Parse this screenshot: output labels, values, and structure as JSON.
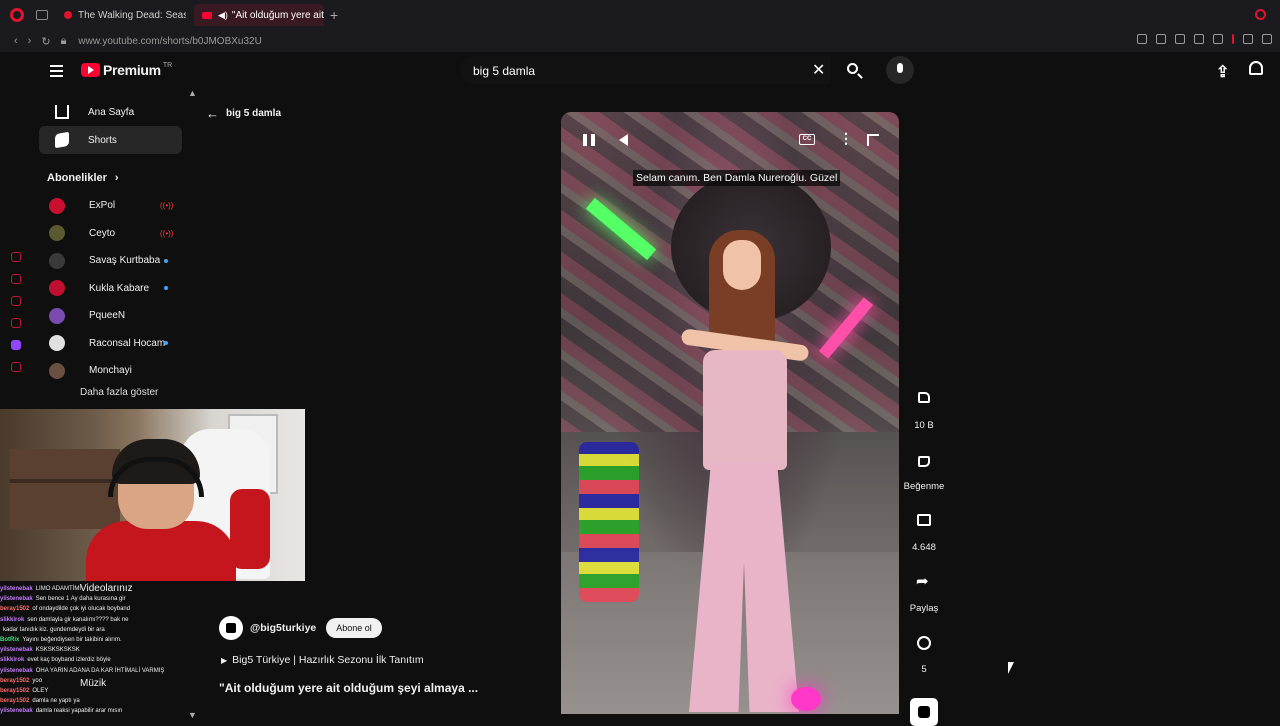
{
  "browser": {
    "tabs": [
      {
        "title": "The Walking Dead: Season",
        "active": false
      },
      {
        "title": "\"Ait olduğum yere ait o",
        "active": true
      }
    ],
    "new_tab": "+",
    "url": "www.youtube.com/shorts/b0JMOBXu32U"
  },
  "header": {
    "logo_text": "Premium",
    "logo_region": "TR",
    "search_value": "big 5 damla",
    "clear_symbol": "✕"
  },
  "sidebar": {
    "items": [
      {
        "label": "Ana Sayfa",
        "icon": "home-icon"
      },
      {
        "label": "Shorts",
        "icon": "shorts-icon",
        "active": true
      }
    ],
    "subscriptions_title": "Abonelikler",
    "subscriptions_chevron": "›",
    "channels": [
      {
        "name": "ExPol",
        "status": "live",
        "avatar_color": "#c8102e"
      },
      {
        "name": "Ceyto",
        "status": "live",
        "avatar_color": "#5a5a30"
      },
      {
        "name": "Savaş Kurtbaba",
        "status": "new",
        "avatar_color": "#3a3a3a"
      },
      {
        "name": "Kukla Kabare",
        "status": "new",
        "avatar_color": "#c01030"
      },
      {
        "name": "PqueeN",
        "status": "none",
        "avatar_color": "#7a4ab0"
      },
      {
        "name": "Raconsal Hocam",
        "status": "new",
        "avatar_color": "#e0e0e0"
      },
      {
        "name": "Monchayi",
        "status": "none",
        "avatar_color": "#6a5040"
      }
    ],
    "show_more": "Daha fazla göster",
    "ghost_items": [
      "Videolarınız",
      "Müzik"
    ],
    "live_symbol": "((•))"
  },
  "chat": [
    {
      "user": "yilstenebak",
      "msg": "LIMO ADAMTİMİ",
      "color": "u"
    },
    {
      "user": "yilstenebak",
      "msg": "Sen bence 1 Ay daha kurasına gir",
      "color": "u"
    },
    {
      "user": "beray1502",
      "msg": "of ondaydilde çok iyi olucak boyband",
      "color": "u2"
    },
    {
      "user": "slikkirok",
      "msg": "sen damlayla gir kanalımı???? bak ne",
      "color": "u"
    },
    {
      "user": "",
      "msg": "kadar tanıdık kiz. gundemdeydi bir ara",
      "color": "u"
    },
    {
      "user": "BotRix",
      "msg": "Yayını beğendiysen bir takibini alırım.",
      "color": "u3"
    },
    {
      "user": "yilstenebak",
      "msg": "KSKSKSKSKSK",
      "color": "u"
    },
    {
      "user": "slikkirok",
      "msg": "evet kaç boyband izlerdiz böyle",
      "color": "u"
    },
    {
      "user": "yilstenebak",
      "msg": "OHA YARIN ADANA DA KAR İHTİMALİ VARMIŞ",
      "color": "u"
    },
    {
      "user": "beray1502",
      "msg": "yoo",
      "color": "u2"
    },
    {
      "user": "beray1502",
      "msg": "OLEY",
      "color": "u2"
    },
    {
      "user": "beray1502",
      "msg": "damla ne yaptı ya",
      "color": "u2"
    },
    {
      "user": "yilstenebak",
      "msg": "damla reaksi yapabilir arar mısın",
      "color": "u"
    }
  ],
  "main": {
    "back_label": "big 5 damla",
    "caption": "Selam canım. Ben Damla Nureroğlu. Güzel",
    "cc_label": "CC",
    "more_symbol": "⋮",
    "actions": [
      {
        "label": "10 B",
        "icon": "like-icon"
      },
      {
        "label": "Beğenme",
        "icon": "dislike-icon"
      },
      {
        "label": "4.648",
        "icon": "comment-icon"
      },
      {
        "label": "Paylaş",
        "icon": "share-icon"
      },
      {
        "label": "5",
        "icon": "remix-icon"
      }
    ],
    "channel_handle": "@big5turkiye",
    "subscribe_label": "Abone ol",
    "playlist": "Big5 Türkiye | Hazırlık Sezonu İlk Tanıtım",
    "playlist_symbol": "▶",
    "title": "\"Ait olduğum yere ait olduğum şeyi almaya ..."
  }
}
